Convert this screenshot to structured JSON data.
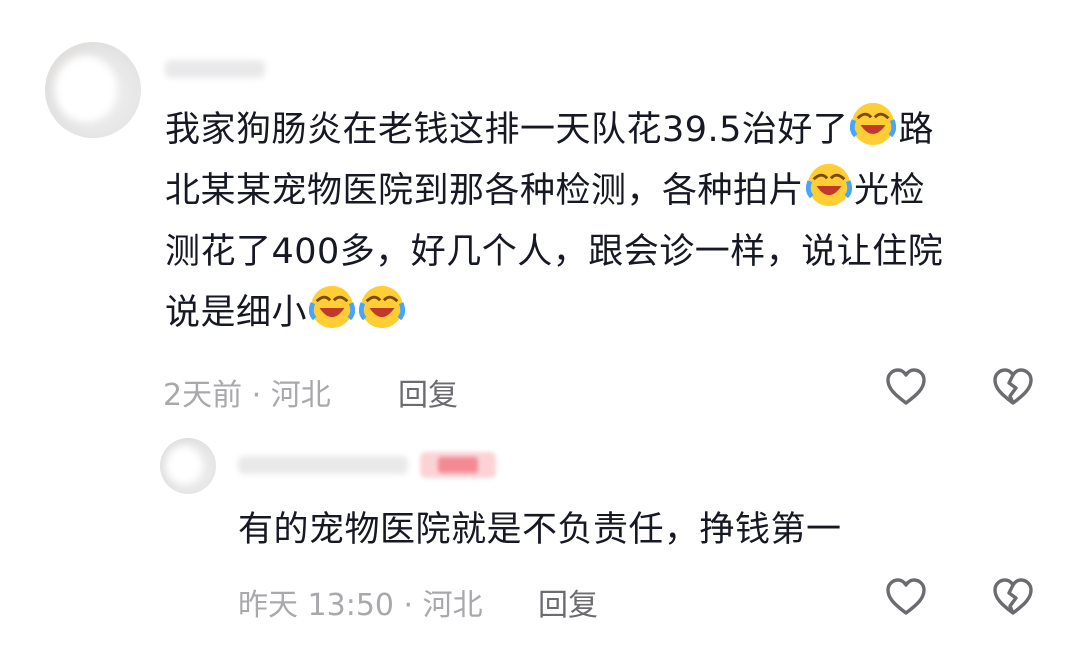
{
  "comment": {
    "text_line1": "我家狗肠炎在老钱这排一天队花39.5治好了",
    "text_line1_tail": "路",
    "text_line2": "北某某宠物医院到那各种检测，各种拍片",
    "text_line2_tail": "光检",
    "text_line3": "测花了400多，好几个人，跟会诊一样，说让住院",
    "text_line4": "说是细小",
    "time_location": "2天前 · 河北",
    "reply_label": "回复"
  },
  "reply_comment": {
    "text": "有的宠物医院就是不负责任，挣钱第一",
    "time_location": "昨天 13:50 · 河北",
    "reply_label": "回复"
  },
  "icons": {
    "like": "heart-outline-icon",
    "dislike": "broken-heart-outline-icon",
    "emoji": "laughing-crying-emoji-icon"
  },
  "colors": {
    "text": "#161823",
    "meta": "#a9a9ad",
    "reply": "#6b6b70",
    "icon": "#6b6b70",
    "author_tag": "#f06b78"
  }
}
